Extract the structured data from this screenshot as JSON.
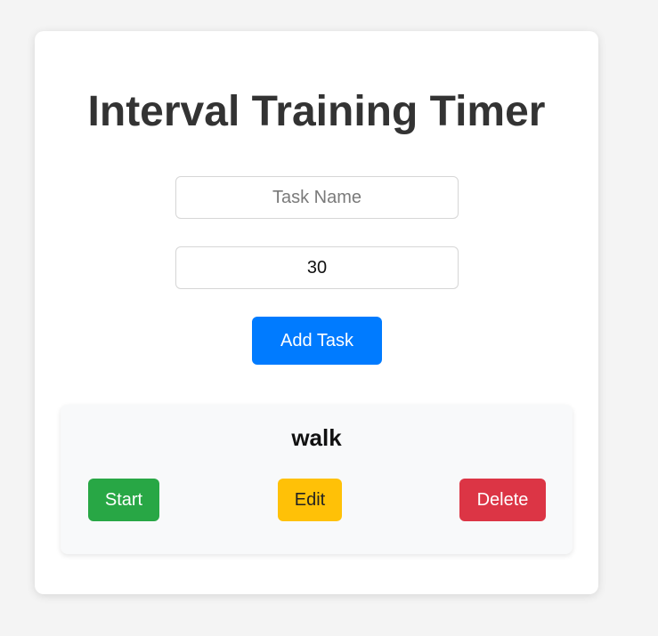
{
  "app": {
    "title": "Interval Training Timer"
  },
  "form": {
    "task_name_placeholder": "Task Name",
    "task_name_value": "",
    "duration_value": "30",
    "add_button_label": "Add Task"
  },
  "tasks": [
    {
      "name": "walk",
      "start_label": "Start",
      "edit_label": "Edit",
      "delete_label": "Delete"
    }
  ],
  "colors": {
    "primary": "#007bff",
    "success": "#28a745",
    "warning": "#ffc107",
    "danger": "#dc3545",
    "title_text": "#333333",
    "page_background": "#f4f4f4"
  }
}
